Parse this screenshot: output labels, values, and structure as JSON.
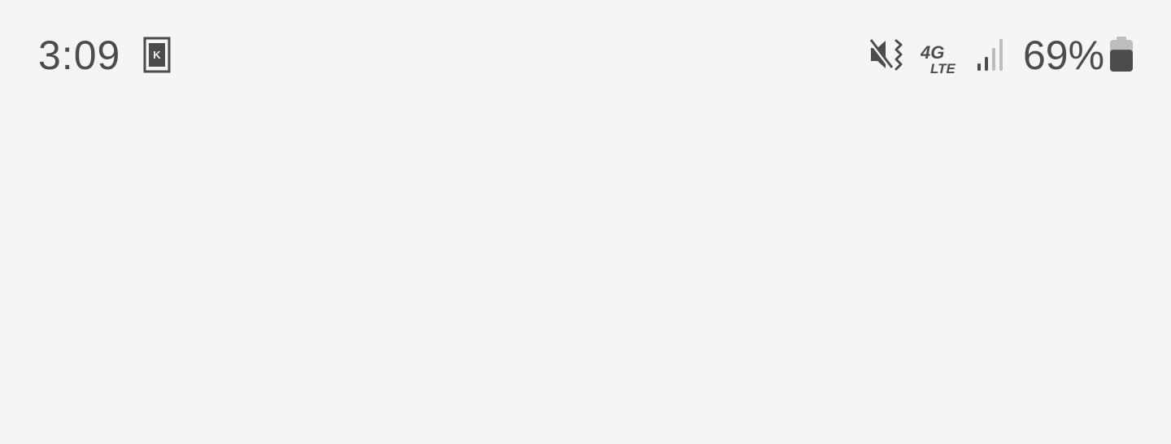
{
  "status_bar": {
    "time": "3:09",
    "notification_icon": "kindle-k-icon",
    "notification_icon_letter": "K",
    "sound_mode_icon": "vibrate-mute-icon",
    "network_type_main": "4G",
    "network_type_sub": "LTE",
    "signal_level": 2,
    "signal_level_max": 4,
    "battery_percent_text": "69%",
    "battery_level": 0.69
  },
  "colors": {
    "background": "#f5f5f8",
    "foreground": "#4c4c4e",
    "inactive_signal": "#bdbdc0"
  }
}
